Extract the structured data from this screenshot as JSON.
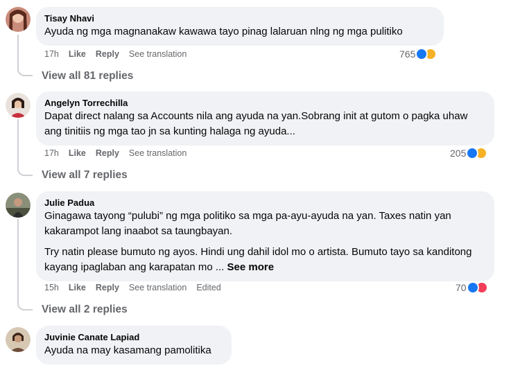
{
  "comments": [
    {
      "author": "Tisay Nhavi",
      "text": [
        "Ayuda ng mga magnanakaw kawawa tayo pinag lalaruan nlng ng mga pulitiko"
      ],
      "time": "17h",
      "like": "Like",
      "reply": "Reply",
      "translate": "See translation",
      "reaction_count": "765",
      "reactions": [
        "like-icon",
        "sad-icon"
      ],
      "view_replies": "View all 81 replies"
    },
    {
      "author": "Angelyn Torrechilla",
      "text": [
        "Dapat direct nalang sa Accounts nila ang ayuda na yan.Sobrang init at gutom o pagka uhaw ang tinitiis ng mga tao jn sa kunting halaga ng ayuda..."
      ],
      "time": "17h",
      "like": "Like",
      "reply": "Reply",
      "translate": "See translation",
      "reaction_count": "205",
      "reactions": [
        "like-icon",
        "sad-icon"
      ],
      "view_replies": "View all 7 replies"
    },
    {
      "author": "Julie Padua",
      "text": [
        "Ginagawa tayong “pulubi” ng mga politiko sa mga pa-ayu-ayuda na yan. Taxes natin yan kakarampot lang inaabot sa taungbayan.",
        "Try natin please bumuto ng ayos. Hindi ung dahil idol mo o artista. Bumuto tayo sa kanditong kayang ipaglaban ang karapatan mo ..."
      ],
      "see_more": "See more",
      "time": "15h",
      "like": "Like",
      "reply": "Reply",
      "translate": "See translation",
      "edited": "Edited",
      "reaction_count": "70",
      "reactions": [
        "like-icon",
        "heart-icon"
      ],
      "view_replies": "View all 2 replies"
    },
    {
      "author": "Juvinie Canate Lapiad",
      "text": [
        "Ayuda na may kasamang pamolitika"
      ]
    }
  ],
  "colors": {
    "bubble": "#f0f2f5",
    "muted": "#65676b",
    "like": "#1877f2",
    "sad": "#f7b125",
    "heart": "#f33e58"
  }
}
